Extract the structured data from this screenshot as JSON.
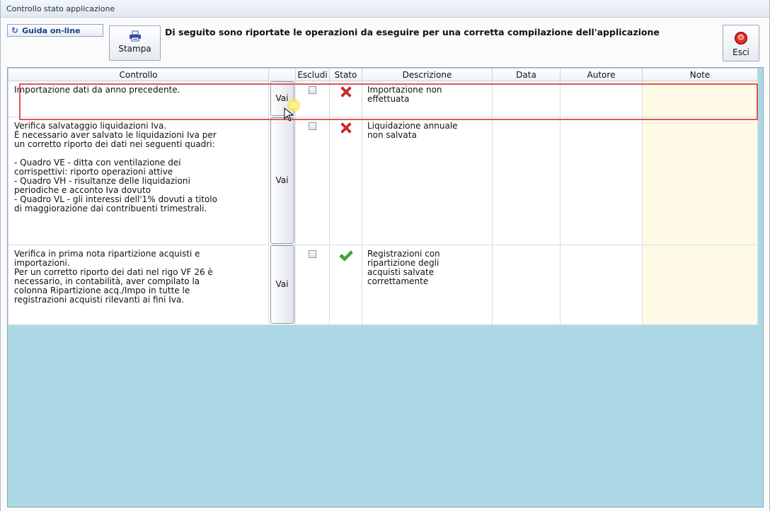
{
  "window": {
    "title": "Controllo stato applicazione"
  },
  "toolbar": {
    "guida_label": "Guida on-line",
    "stampa_label": "Stampa",
    "instructions": "Di seguito sono riportate le operazioni da eseguire per una corretta compilazione dell'applicazione",
    "esci_label": "Esci"
  },
  "grid": {
    "columns": [
      "Controllo",
      "",
      "Escludi",
      "Stato",
      "Descrizione",
      "Data",
      "Autore",
      "Note"
    ],
    "rows": [
      {
        "controllo": [
          "Importazione dati da anno precedente."
        ],
        "vai": "Vai",
        "escludi": false,
        "stato": "error",
        "descrizione": [
          "Importazione non",
          "effettuata"
        ],
        "data": "",
        "autore": "",
        "note": ""
      },
      {
        "controllo": [
          "Verifica salvataggio liquidazioni Iva.",
          "È necessario aver salvato le liquidazioni Iva per",
          "un corretto riporto dei dati nei seguenti quadri:",
          "",
          "- Quadro VE - ditta con ventilazione dei",
          "corrispettivi: riporto operazioni attive",
          "- Quadro VH - risultanze delle liquidazioni",
          "periodiche e acconto Iva dovuto",
          "- Quadro VL - gli interessi dell'1% dovuti a titolo",
          "di maggiorazione dai contribuenti trimestrali."
        ],
        "vai": "Vai",
        "escludi": false,
        "stato": "error",
        "descrizione": [
          "Liquidazione annuale",
          "non salvata"
        ],
        "data": "",
        "autore": "",
        "note": ""
      },
      {
        "controllo": [
          "Verifica in prima nota ripartizione acquisti e",
          "importazioni.",
          "Per un corretto riporto dei dati nel rigo VF 26 è",
          "necessario, in contabilità, aver compilato la",
          "colonna Ripartizione acq./Impo in tutte le",
          "registrazioni acquisti rilevanti ai fini Iva."
        ],
        "vai": "Vai",
        "escludi": false,
        "stato": "ok",
        "descrizione": [
          "Registrazioni con",
          "ripartizione degli",
          "acquisti salvate",
          "correttamente"
        ],
        "data": "",
        "autore": "",
        "note": ""
      }
    ]
  },
  "colors": {
    "grid_background": "#add8e6",
    "note_column": "#fffae6",
    "highlight_border": "#e0555a",
    "error_icon": "#e02b2b",
    "ok_icon": "#3fb23a"
  }
}
